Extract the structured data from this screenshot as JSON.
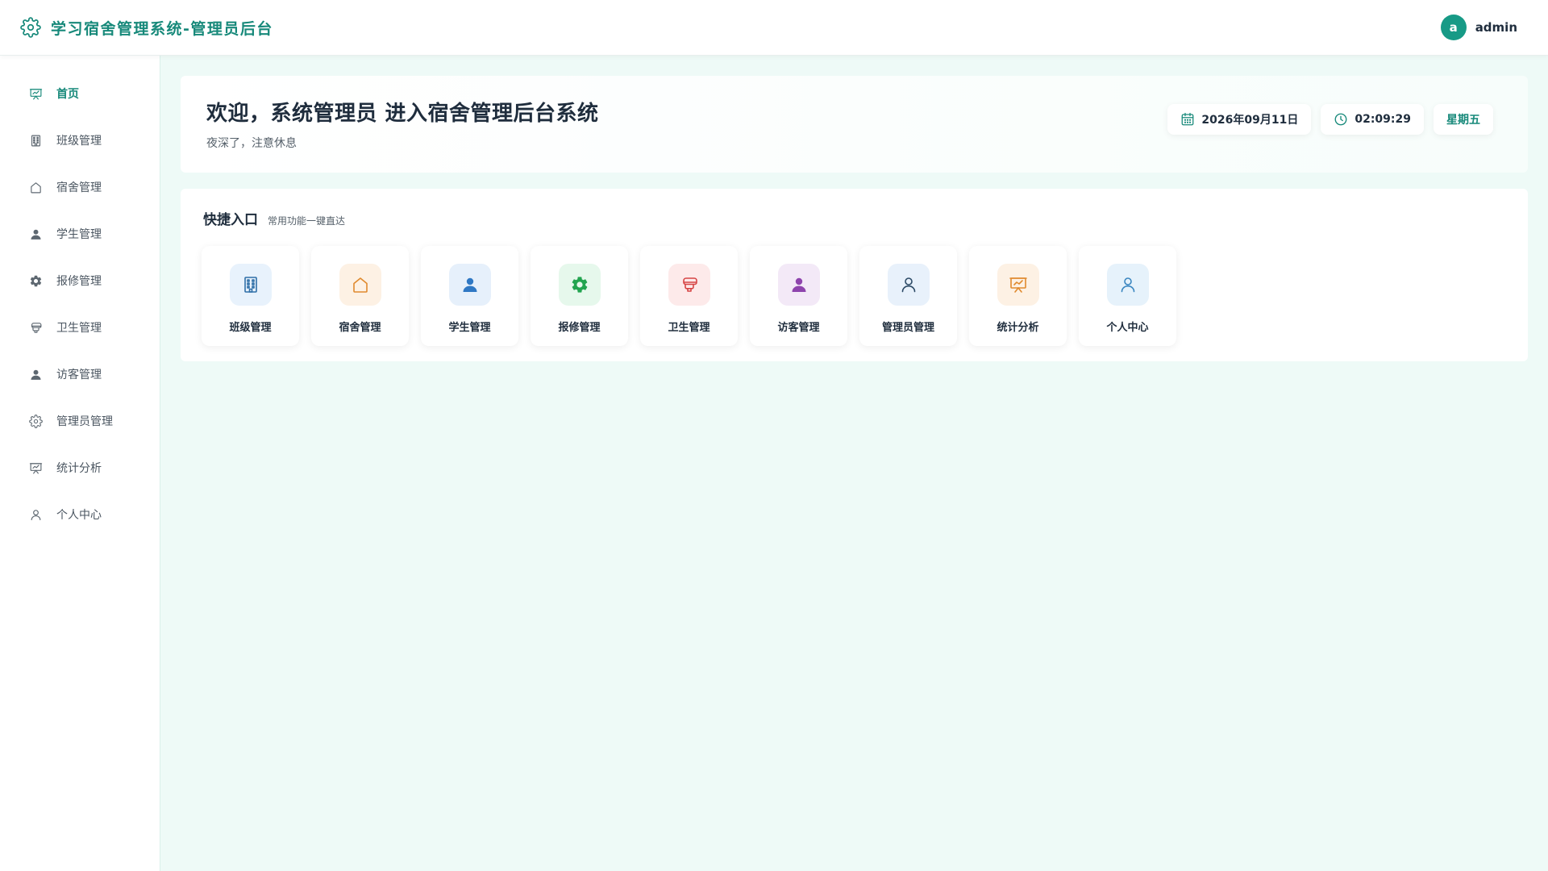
{
  "header": {
    "title": "学习宿舍管理系统-管理员后台",
    "logo_icon": "gear-icon",
    "avatar_letter": "a",
    "username": "admin"
  },
  "sidebar": {
    "items": [
      {
        "label": "首页",
        "icon": "presentation-chart-icon",
        "active": true
      },
      {
        "label": "班级管理",
        "icon": "building-icon"
      },
      {
        "label": "宿舍管理",
        "icon": "house-icon"
      },
      {
        "label": "学生管理",
        "icon": "user-solid-icon"
      },
      {
        "label": "报修管理",
        "icon": "gear-solid-icon"
      },
      {
        "label": "卫生管理",
        "icon": "toilet-paper-icon"
      },
      {
        "label": "访客管理",
        "icon": "user-solid-icon"
      },
      {
        "label": "管理员管理",
        "icon": "gear-outline-icon"
      },
      {
        "label": "统计分析",
        "icon": "presentation-chart-icon"
      },
      {
        "label": "个人中心",
        "icon": "user-outline-icon"
      }
    ]
  },
  "welcome": {
    "heading": "欢迎，系统管理员 进入宿舍管理后台系统",
    "subtitle": "夜深了，注意休息",
    "date": "2026年09月11日",
    "time": "02:09:29",
    "weekday": "星期五"
  },
  "quick": {
    "title": "快捷入口",
    "subtitle": "常用功能一键直达",
    "tiles": [
      {
        "label": "班级管理",
        "icon": "building-icon",
        "bg": "#e8f2fc",
        "color": "#2f6fa8"
      },
      {
        "label": "宿舍管理",
        "icon": "house-icon",
        "bg": "#fdf1e4",
        "color": "#e08a2e"
      },
      {
        "label": "学生管理",
        "icon": "user-solid-icon",
        "bg": "#e6f0fb",
        "color": "#2f78c4"
      },
      {
        "label": "报修管理",
        "icon": "gear-solid-icon",
        "bg": "#e6f8ec",
        "color": "#22a44f"
      },
      {
        "label": "卫生管理",
        "icon": "toilet-paper-icon",
        "bg": "#fdeaea",
        "color": "#d64545"
      },
      {
        "label": "访客管理",
        "icon": "user-solid-icon",
        "bg": "#f3e9f7",
        "color": "#8e44ad"
      },
      {
        "label": "管理员管理",
        "icon": "user-outline-icon",
        "bg": "#e8f1fb",
        "color": "#2c4a66"
      },
      {
        "label": "统计分析",
        "icon": "presentation-chart-icon",
        "bg": "#fdf1e4",
        "color": "#e08a2e"
      },
      {
        "label": "个人中心",
        "icon": "user-outline-icon",
        "bg": "#e6f2fb",
        "color": "#3a86c0"
      }
    ]
  }
}
